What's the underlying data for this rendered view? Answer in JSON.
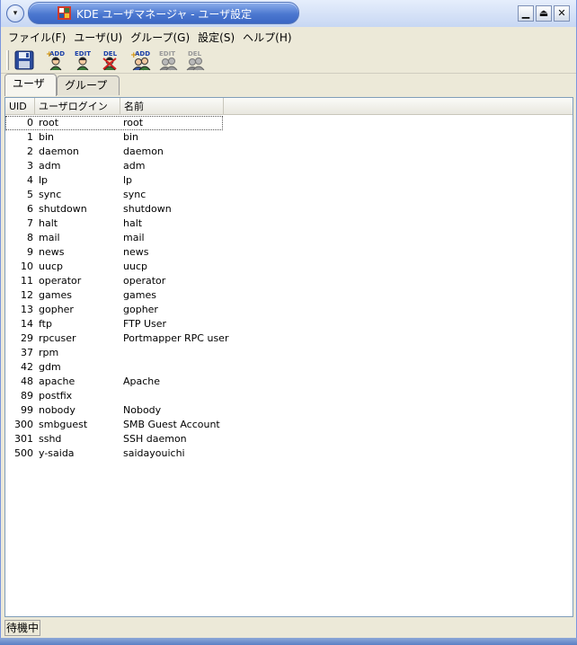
{
  "window": {
    "title": "KDE ユーザマネージャ - ユーザ設定",
    "menu_button_glyph": "▾",
    "minimize_glyph": "▁",
    "maximize_glyph": "⏏",
    "close_glyph": "✕"
  },
  "menubar": {
    "items": [
      "ファイル(F)",
      "ユーザ(U)",
      "グループ(G)",
      "設定(S)",
      "ヘルプ(H)"
    ]
  },
  "toolbar": {
    "buttons": [
      {
        "name": "save-icon",
        "label": ""
      },
      {
        "name": "add-user-icon",
        "label": "ADD"
      },
      {
        "name": "edit-user-icon",
        "label": "EDIT"
      },
      {
        "name": "delete-user-icon",
        "label": "DEL"
      },
      {
        "name": "add-group-icon",
        "label": "ADD"
      },
      {
        "name": "edit-group-icon",
        "label": "EDIT"
      },
      {
        "name": "delete-group-icon",
        "label": "DEL"
      }
    ]
  },
  "tabs": [
    {
      "label": "ユーザ",
      "active": true
    },
    {
      "label": "グループ",
      "active": false
    }
  ],
  "table": {
    "headers": {
      "uid": "UID",
      "login": "ユーザログイン",
      "name": "名前"
    },
    "rows": [
      {
        "uid": "0",
        "login": "root",
        "name": "root"
      },
      {
        "uid": "1",
        "login": "bin",
        "name": "bin"
      },
      {
        "uid": "2",
        "login": "daemon",
        "name": "daemon"
      },
      {
        "uid": "3",
        "login": "adm",
        "name": "adm"
      },
      {
        "uid": "4",
        "login": "lp",
        "name": "lp"
      },
      {
        "uid": "5",
        "login": "sync",
        "name": "sync"
      },
      {
        "uid": "6",
        "login": "shutdown",
        "name": "shutdown"
      },
      {
        "uid": "7",
        "login": "halt",
        "name": "halt"
      },
      {
        "uid": "8",
        "login": "mail",
        "name": "mail"
      },
      {
        "uid": "9",
        "login": "news",
        "name": "news"
      },
      {
        "uid": "10",
        "login": "uucp",
        "name": "uucp"
      },
      {
        "uid": "11",
        "login": "operator",
        "name": "operator"
      },
      {
        "uid": "12",
        "login": "games",
        "name": "games"
      },
      {
        "uid": "13",
        "login": "gopher",
        "name": "gopher"
      },
      {
        "uid": "14",
        "login": "ftp",
        "name": "FTP User"
      },
      {
        "uid": "29",
        "login": "rpcuser",
        "name": "Portmapper RPC user"
      },
      {
        "uid": "37",
        "login": "rpm",
        "name": ""
      },
      {
        "uid": "42",
        "login": "gdm",
        "name": ""
      },
      {
        "uid": "48",
        "login": "apache",
        "name": "Apache"
      },
      {
        "uid": "89",
        "login": "postfix",
        "name": ""
      },
      {
        "uid": "99",
        "login": "nobody",
        "name": "Nobody"
      },
      {
        "uid": "300",
        "login": "smbguest",
        "name": "SMB Guest Account"
      },
      {
        "uid": "301",
        "login": "sshd",
        "name": "SSH daemon"
      },
      {
        "uid": "500",
        "login": "y-saida",
        "name": "saidayouichi"
      }
    ]
  },
  "statusbar": {
    "text": "待機中"
  }
}
